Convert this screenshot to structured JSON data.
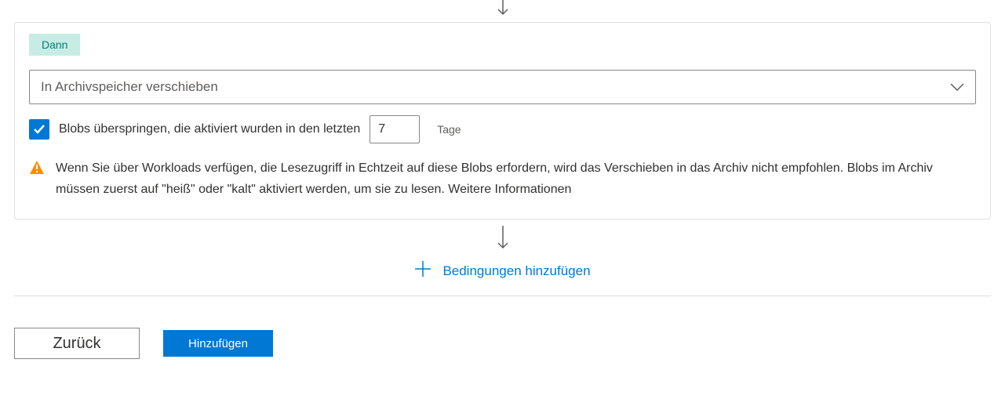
{
  "then_block": {
    "badge": "Dann",
    "action_select": "In Archivspeicher verschieben",
    "skip_checkbox_label": "Blobs überspringen, die aktiviert wurden in den letzten",
    "skip_days_value": "7",
    "days_suffix": "Tage",
    "warning_text": "Wenn Sie über Workloads verfügen, die Lesezugriff in Echtzeit auf diese Blobs erfordern, wird das Verschieben in das Archiv nicht empfohlen. Blobs im Archiv müssen zuerst auf \"heiß\" oder \"kalt\" aktiviert werden, um sie zu lesen. Weitere Informationen"
  },
  "add_conditions_label": "Bedingungen hinzufügen",
  "footer": {
    "back": "Zurück",
    "add": "Hinzufügen"
  }
}
